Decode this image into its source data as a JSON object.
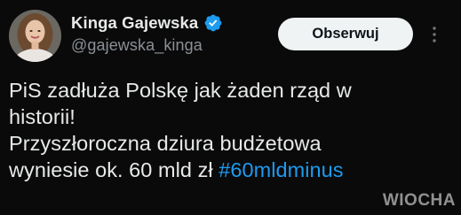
{
  "tweet": {
    "author": {
      "display_name": "Kinga Gajewska",
      "handle": "@gajewska_kinga",
      "verified": true,
      "avatar": "avatar-photo"
    },
    "follow_button_label": "Obserwuj",
    "more_icon": "more-vertical-icon",
    "text_lines": [
      "PiS zadłuża Polskę jak żaden rząd w",
      "historii!",
      "Przyszłoroczna dziura budżetowa"
    ],
    "last_line_text": "wyniesie ok. 60 mld zł",
    "hashtag": "#60mldminus"
  },
  "watermark": {
    "text": "WIOCHA"
  },
  "colors": {
    "background": "#0a0a0a",
    "text_primary": "#e7e9ea",
    "text_secondary": "#8b9096",
    "hashtag": "#1d9bf0",
    "verified_badge": "#1d9bf0",
    "follow_button_bg": "#eff3f4"
  }
}
